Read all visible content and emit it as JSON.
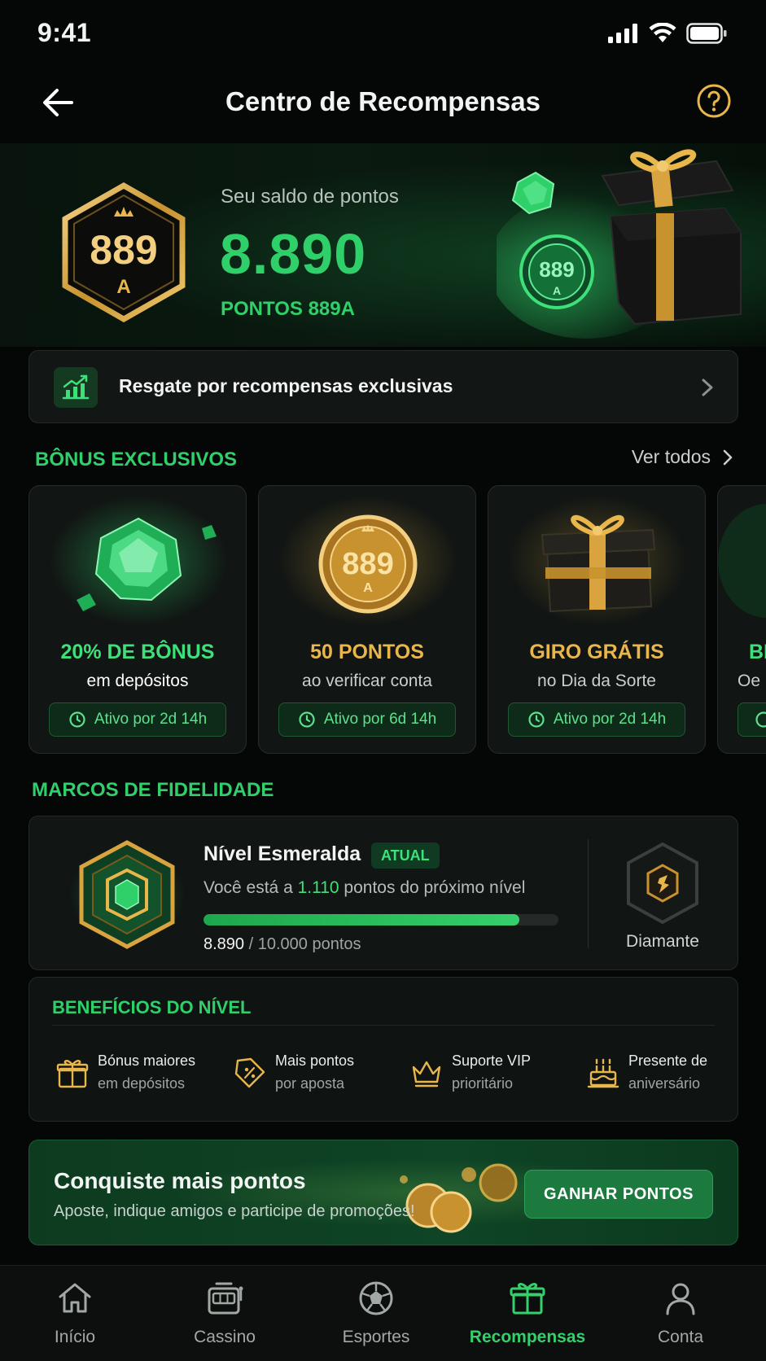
{
  "status_bar": {
    "time": "9:41"
  },
  "header": {
    "title": "Centro de Recompensas"
  },
  "hero": {
    "label": "Seu saldo de pontos",
    "points": "8.890",
    "unit": "PONTOS 889A",
    "badge_number": "889",
    "badge_letter": "A"
  },
  "redeem": {
    "label": "Resgate por recompensas exclusivas"
  },
  "bonus_section": {
    "title": "BÔNUS EXCLUSIVOS",
    "see_all": "Ver todos"
  },
  "bonus_cards": [
    {
      "title": "20% DE BÔNUS",
      "subtitle": "em depósitos",
      "timer": "Ativo por 2d 14h",
      "title_color": "#3ee07a",
      "subtitle_color": "#ffffff"
    },
    {
      "title": "50 PONTOS",
      "subtitle": "ao verificar conta",
      "timer": "Ativo por 6d 14h",
      "title_color": "#e8b64a",
      "subtitle_color": "#c9cfcc"
    },
    {
      "title": "GIRO GRÁTIS",
      "subtitle": "no Dia da Sorte",
      "timer": "Ativo por 2d 14h",
      "title_color": "#e8b64a",
      "subtitle_color": "#c9cfcc"
    },
    {
      "title": "BI",
      "subtitle": "Oe",
      "timer": "",
      "title_color": "#3ee07a",
      "subtitle_color": "#c9cfcc"
    }
  ],
  "loyalty": {
    "section_title": "MARCOS DE FIDELIDADE",
    "level_name": "Nível Esmeralda",
    "tag": "ATUAL",
    "next_prefix": "Você está a ",
    "next_points": "1.110",
    "next_suffix": " pontos do próximo nível",
    "current": "8.890",
    "goal_text": " / 10.000 pontos",
    "progress": 0.889,
    "next_level": "Diamante"
  },
  "benefits": {
    "title": "BENEFÍCIOS DO NÍVEL",
    "items": [
      {
        "icon": "gift-icon",
        "line1": "Bónus maiores",
        "line2": "em depósitos"
      },
      {
        "icon": "percent-tag-icon",
        "line1": "Mais pontos",
        "line2": "por aposta"
      },
      {
        "icon": "crown-icon",
        "line1": "Suporte VIP",
        "line2": "prioritário"
      },
      {
        "icon": "cake-icon",
        "line1": "Presente de",
        "line2": "aniversário"
      }
    ]
  },
  "earn": {
    "title": "Conquiste mais pontos",
    "subtitle": "Aposte, indique amigos e participe de promoções!",
    "button": "GANHAR PONTOS"
  },
  "nav": {
    "items": [
      {
        "icon": "home-icon",
        "label": "Início",
        "active": false
      },
      {
        "icon": "slot-machine-icon",
        "label": "Cassino",
        "active": false
      },
      {
        "icon": "soccer-ball-icon",
        "label": "Esportes",
        "active": false
      },
      {
        "icon": "gift-icon",
        "label": "Recompensas",
        "active": true
      },
      {
        "icon": "user-icon",
        "label": "Conta",
        "active": false
      }
    ]
  },
  "colors": {
    "accent": "#2fd06a",
    "gold": "#e8b64a",
    "background": "#050706"
  }
}
